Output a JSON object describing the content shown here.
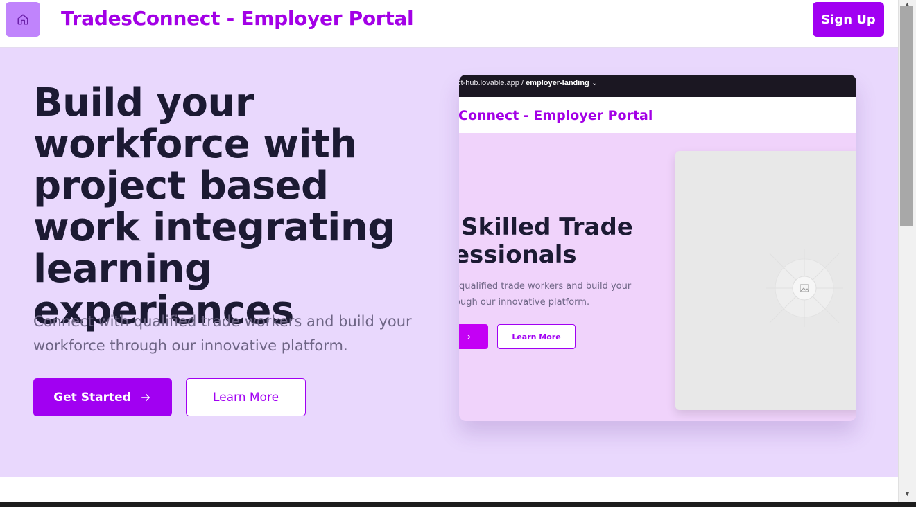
{
  "header": {
    "title": "TradesConnect - Employer Portal",
    "home_icon": "home-icon",
    "signup_label": "Sign Up"
  },
  "hero": {
    "title": "Build your workforce with project based work integrating learning experiences",
    "subtitle": "Connect with qualified trade workers and build your workforce through our innovative platform.",
    "get_started_label": "Get Started",
    "get_started_icon": "arrow-right-icon",
    "learn_more_label": "Learn More"
  },
  "preview": {
    "url_prefix": "ct-hub.lovable.app / ",
    "url_path": "employer-landing",
    "title": "Connect - Employer Portal",
    "heading_line1": "Skilled Trade",
    "heading_line2": "essionals",
    "sub_line1": "qualified trade workers and build your",
    "sub_line2": "ough our innovative platform.",
    "primary_icon": "arrow-right-icon",
    "learn_more_label": "Learn More",
    "image_icon": "image-placeholder-icon"
  },
  "colors": {
    "brand": "#a100f2",
    "hero_bg": "#e9d8fd",
    "heading": "#1c1a33"
  }
}
